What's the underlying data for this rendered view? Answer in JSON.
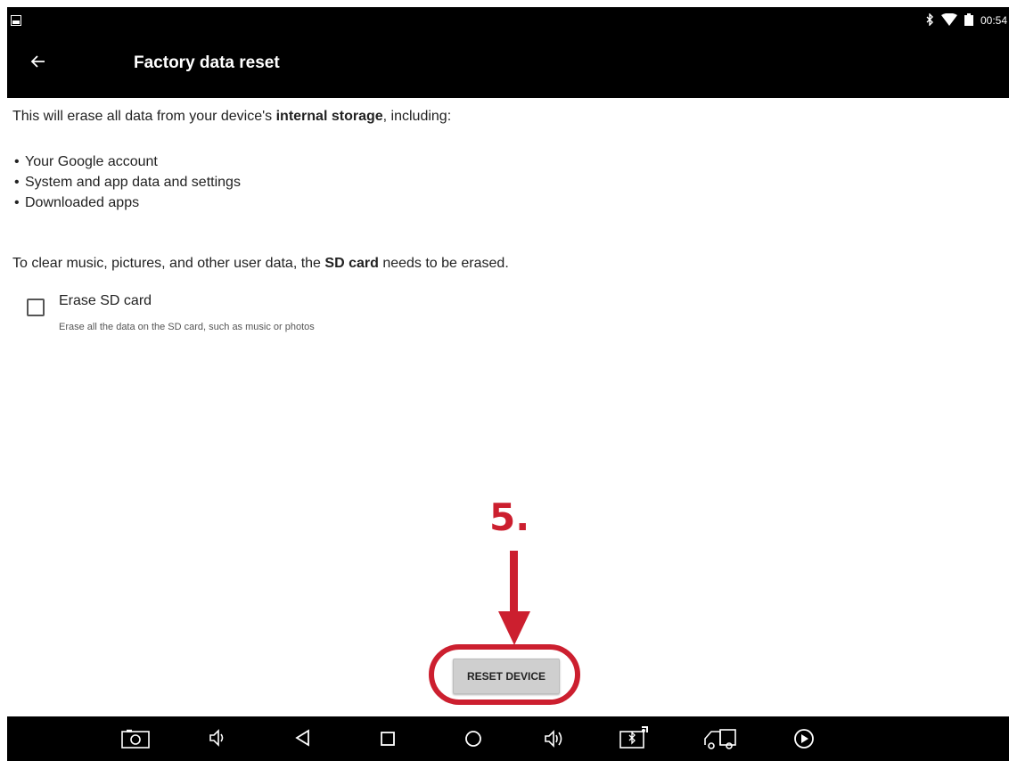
{
  "status_bar": {
    "time": "00:54",
    "icons": [
      "screenshot-icon",
      "bluetooth-icon",
      "wifi-icon",
      "battery-icon"
    ]
  },
  "app_bar": {
    "title": "Factory data reset",
    "back_icon": "back-arrow-icon"
  },
  "content": {
    "intro_prefix": "This will erase all data from your device's ",
    "intro_bold": "internal storage",
    "intro_suffix": ", including:",
    "bullets": [
      "Your Google account",
      "System and app data and settings",
      "Downloaded apps"
    ],
    "sd_prefix": "To clear music, pictures, and other user data, the ",
    "sd_bold": "SD card",
    "sd_suffix": " needs to be erased.",
    "checkbox_label": "Erase SD card",
    "checkbox_sublabel": "Erase all the data on the SD card, such as music or photos",
    "checkbox_checked": false
  },
  "annotation": {
    "step_label": "5.",
    "color": "#cc1f2f"
  },
  "reset_button": {
    "label": "RESET DEVICE"
  },
  "nav_bar": {
    "icons": [
      "camera-icon",
      "volume-down-icon",
      "back-icon",
      "recents-icon",
      "home-icon",
      "volume-up-icon",
      "bluetooth-settings-icon",
      "car-icon",
      "play-icon"
    ]
  }
}
